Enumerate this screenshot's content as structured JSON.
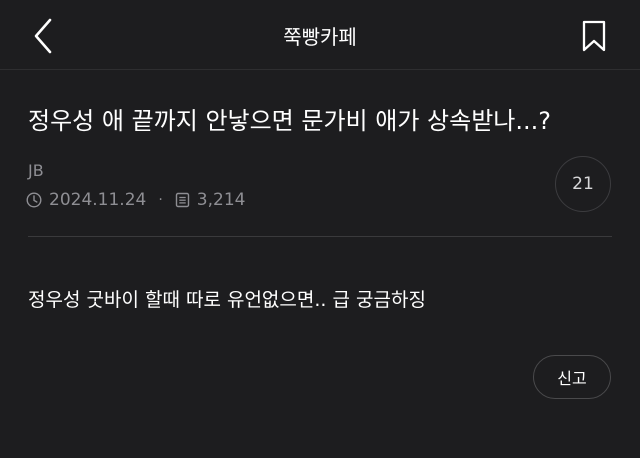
{
  "header": {
    "title": "쭉빵카페",
    "back_icon": "chevron-left-icon",
    "bookmark_icon": "bookmark-icon"
  },
  "post": {
    "title": "정우성 애 끝까지 안낳으면 문가비 애가 상속받나...?",
    "author": "JB",
    "date": "2024.11.24",
    "separator": "·",
    "views": "3,214",
    "comment_count": "21",
    "body": "정우성 굿바이 할때 따로 유언없으면.. 급 궁금하징"
  },
  "actions": {
    "report_label": "신고"
  },
  "colors": {
    "background": "#1d1d1f",
    "text_primary": "#ffffff",
    "text_secondary": "#8e8e93",
    "border": "#3a3a3c"
  }
}
